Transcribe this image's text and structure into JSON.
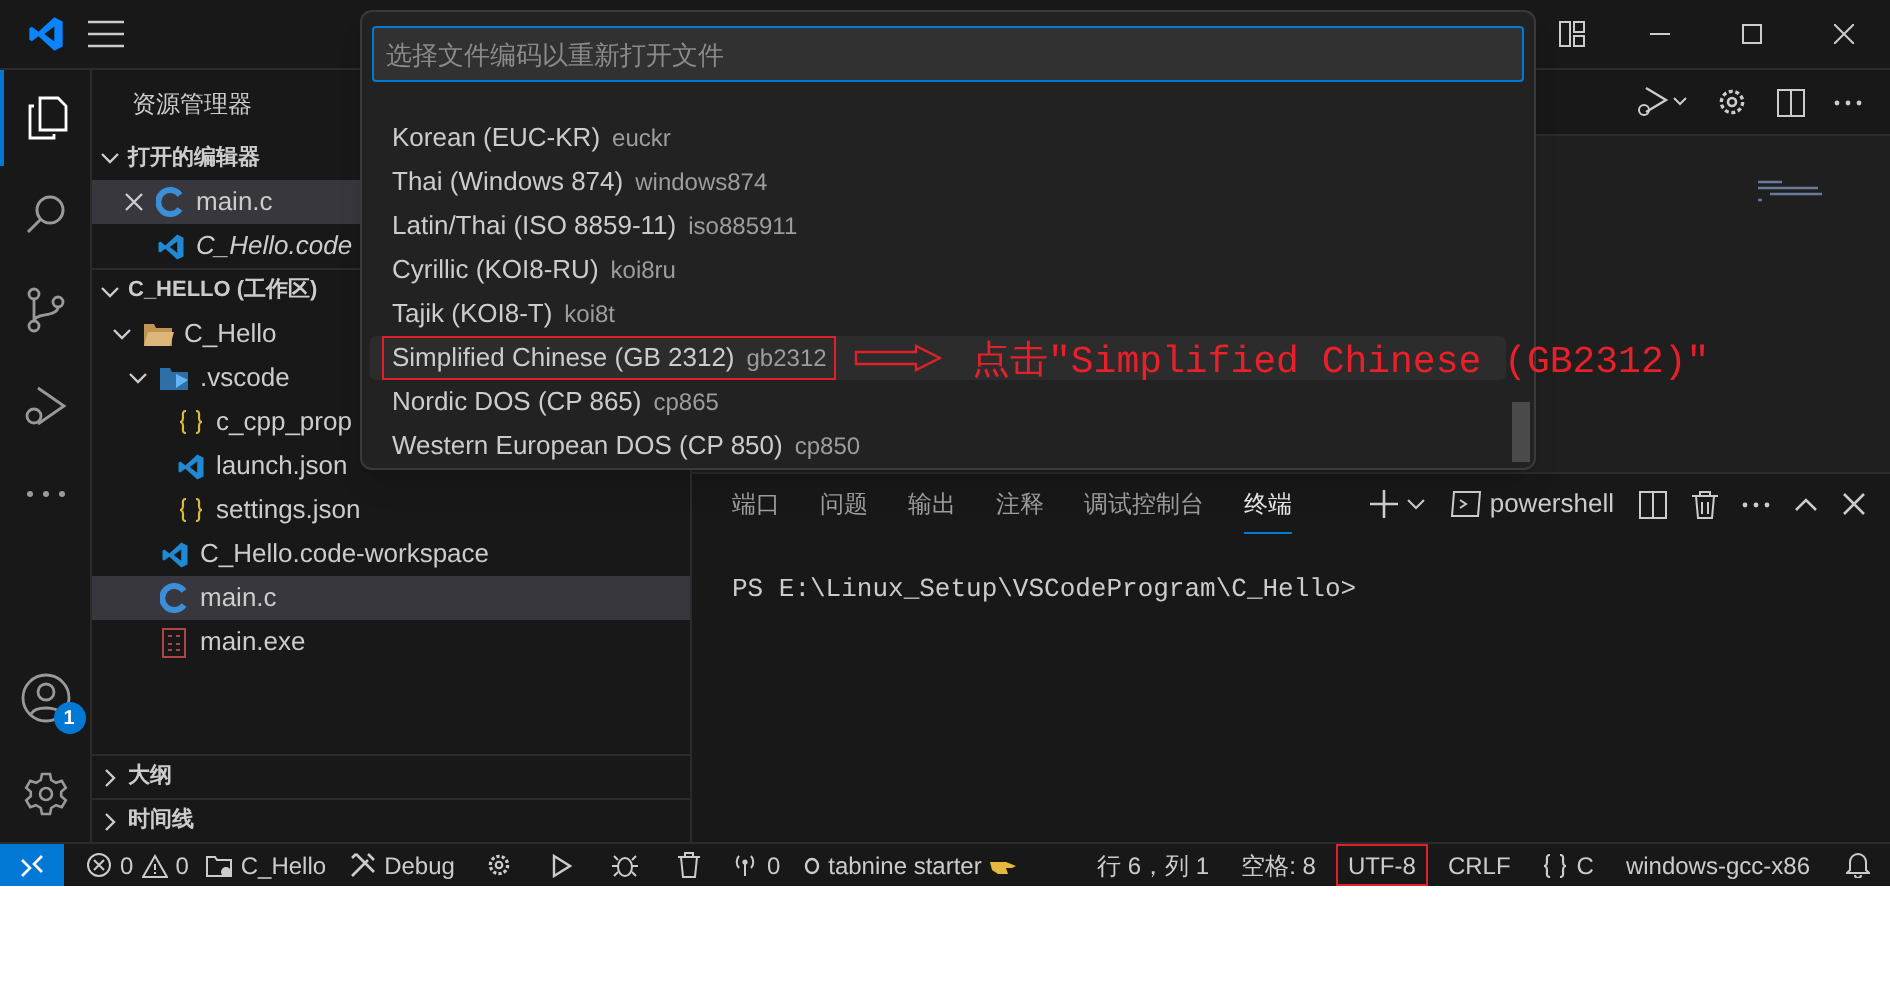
{
  "activity_bar": {
    "account_badge": "1"
  },
  "sidebar": {
    "title": "资源管理器",
    "open_editors": {
      "label": "打开的编辑器",
      "expanded": true,
      "items": [
        {
          "name": "main.c",
          "kind": "c",
          "selected": true,
          "preview": false
        },
        {
          "name": "C_Hello.code",
          "kind": "vscode",
          "selected": false,
          "preview": true
        }
      ]
    },
    "workspace": {
      "label": "C_HELLO (工作区)",
      "expanded": true,
      "tree": [
        {
          "name": "C_Hello",
          "kind": "folder",
          "expanded": true,
          "selected": false,
          "children": [
            {
              "name": ".vscode",
              "kind": "vscode-folder",
              "expanded": true,
              "selected": false,
              "children": [
                {
                  "name": "c_cpp_prop",
                  "kind": "json",
                  "selected": false
                },
                {
                  "name": "launch.json",
                  "kind": "vscode",
                  "selected": false
                },
                {
                  "name": "settings.json",
                  "kind": "json",
                  "selected": false
                }
              ]
            },
            {
              "name": "C_Hello.code-workspace",
              "kind": "vscode",
              "selected": false
            },
            {
              "name": "main.c",
              "kind": "c",
              "selected": true
            },
            {
              "name": "main.exe",
              "kind": "exe",
              "selected": false
            }
          ]
        }
      ]
    },
    "collapsed_sections": [
      {
        "label": "大纲",
        "expanded": false
      },
      {
        "label": "时间线",
        "expanded": false
      }
    ]
  },
  "quick_pick": {
    "placeholder": "选择文件编码以重新打开文件",
    "items": [
      {
        "label": "Korean (EUC-KR)",
        "description": "euckr",
        "selected": false
      },
      {
        "label": "Thai (Windows 874)",
        "description": "windows874",
        "selected": false
      },
      {
        "label": "Latin/Thai (ISO 8859-11)",
        "description": "iso885911",
        "selected": false
      },
      {
        "label": "Cyrillic (KOI8-RU)",
        "description": "koi8ru",
        "selected": false
      },
      {
        "label": "Tajik (KOI8-T)",
        "description": "koi8t",
        "selected": false
      },
      {
        "label": "Simplified Chinese (GB 2312)",
        "description": "gb2312",
        "selected": true
      },
      {
        "label": "Nordic DOS (CP 865)",
        "description": "cp865",
        "selected": false
      },
      {
        "label": "Western European DOS (CP 850)",
        "description": "cp850",
        "selected": false
      }
    ]
  },
  "annotation": {
    "text": "点击″Simplified Chinese (GB2312)″"
  },
  "panel": {
    "tabs": [
      {
        "label": "端口",
        "selected": false
      },
      {
        "label": "问题",
        "selected": false
      },
      {
        "label": "输出",
        "selected": false
      },
      {
        "label": "注释",
        "selected": false
      },
      {
        "label": "调试控制台",
        "selected": false
      },
      {
        "label": "终端",
        "selected": true
      }
    ],
    "terminal_profile": "powershell",
    "terminal_lines": [
      "PS E:\\Linux_Setup\\VSCodeProgram\\C_Hello>"
    ]
  },
  "status_bar": {
    "left": [
      {
        "kind": "remote"
      },
      {
        "kind": "problems",
        "errors": "0",
        "warnings": "0"
      },
      {
        "kind": "folder",
        "text": "C_Hello"
      },
      {
        "kind": "tools",
        "text": "Debug"
      },
      {
        "kind": "gear"
      },
      {
        "kind": "play"
      },
      {
        "kind": "bug"
      },
      {
        "kind": "trash"
      },
      {
        "kind": "broadcast",
        "text": "0"
      },
      {
        "kind": "tabnine",
        "text": "tabnine starter"
      }
    ],
    "right": [
      {
        "kind": "text",
        "text": "行 6，列 1",
        "annotated": false
      },
      {
        "kind": "text",
        "text": "空格: 8",
        "annotated": false
      },
      {
        "kind": "text",
        "text": "UTF-8",
        "annotated": true
      },
      {
        "kind": "text",
        "text": "CRLF",
        "annotated": false
      },
      {
        "kind": "braces",
        "text": "C",
        "annotated": false
      },
      {
        "kind": "text",
        "text": "windows-gcc-x86",
        "annotated": false
      },
      {
        "kind": "bell"
      }
    ]
  }
}
